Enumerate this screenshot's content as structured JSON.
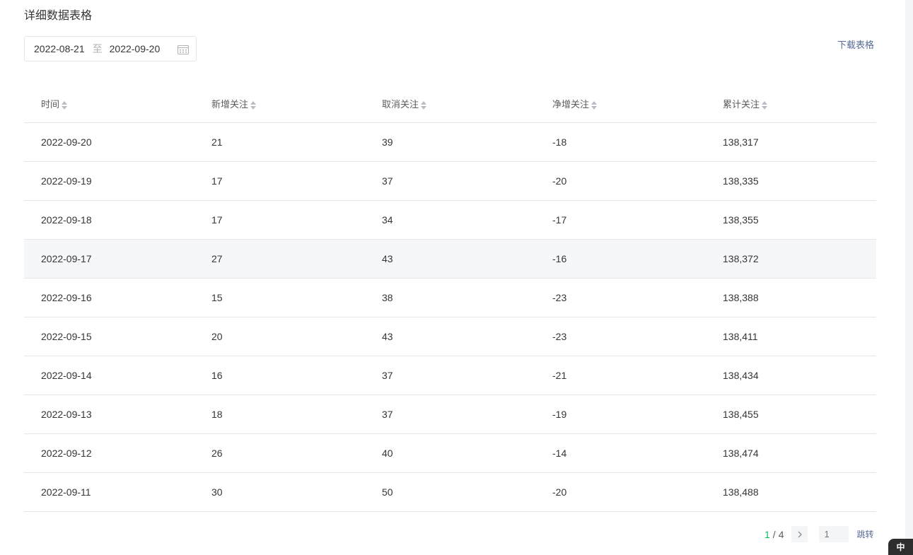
{
  "section_title": "详细数据表格",
  "date_range": {
    "start": "2022-08-21",
    "separator": "至",
    "end": "2022-09-20",
    "icon": "calendar-icon"
  },
  "download_label": "下载表格",
  "table": {
    "columns": [
      "时间",
      "新增关注",
      "取消关注",
      "净增关注",
      "累计关注"
    ],
    "rows": [
      [
        "2022-09-20",
        "21",
        "39",
        "-18",
        "138,317"
      ],
      [
        "2022-09-19",
        "17",
        "37",
        "-20",
        "138,335"
      ],
      [
        "2022-09-18",
        "17",
        "34",
        "-17",
        "138,355"
      ],
      [
        "2022-09-17",
        "27",
        "43",
        "-16",
        "138,372"
      ],
      [
        "2022-09-16",
        "15",
        "38",
        "-23",
        "138,388"
      ],
      [
        "2022-09-15",
        "20",
        "43",
        "-23",
        "138,411"
      ],
      [
        "2022-09-14",
        "16",
        "37",
        "-21",
        "138,434"
      ],
      [
        "2022-09-13",
        "18",
        "37",
        "-19",
        "138,455"
      ],
      [
        "2022-09-12",
        "26",
        "40",
        "-14",
        "138,474"
      ],
      [
        "2022-09-11",
        "30",
        "50",
        "-20",
        "138,488"
      ]
    ],
    "highlighted_row": 3
  },
  "pagination": {
    "current": "1",
    "separator": "/",
    "total": "4",
    "next_icon": "chevron-right-icon",
    "input_placeholder": "1",
    "jump_label": "跳转"
  },
  "ime_indicator": "中",
  "colors": {
    "accent_green": "#07c160",
    "link_blue": "#576b95",
    "text": "#353535",
    "border": "#e7e7eb",
    "row_highlight": "#f6f7f9"
  }
}
